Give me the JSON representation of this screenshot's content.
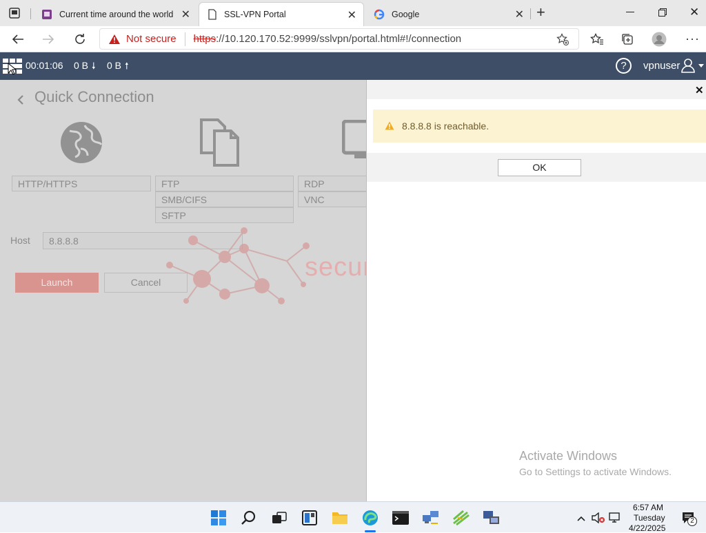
{
  "browser": {
    "tabs": [
      {
        "title": "Current time around the world",
        "active": false
      },
      {
        "title": "SSL-VPN Portal",
        "active": true
      },
      {
        "title": "Google",
        "active": false
      }
    ],
    "address": {
      "security_label": "Not secure",
      "scheme": "https",
      "url_rest": "://10.120.170.52:9999/sslvpn/portal.html#!/connection"
    }
  },
  "portal": {
    "session_time": "00:01:06",
    "bytes_down": "0 B",
    "bytes_up": "0 B",
    "username": "vpnuser"
  },
  "quick_connection": {
    "title": "Quick Connection",
    "col1": [
      "HTTP/HTTPS"
    ],
    "col2": [
      "FTP",
      "SMB/CIFS",
      "SFTP"
    ],
    "col3": [
      "RDP",
      "VNC"
    ],
    "host_label": "Host",
    "host_value": "8.8.8.8",
    "launch_label": "Launch",
    "cancel_label": "Cancel"
  },
  "watermark": "securityzone.vn",
  "dialog": {
    "message": "8.8.8.8 is reachable.",
    "ok_label": "OK"
  },
  "activate_windows": {
    "title": "Activate Windows",
    "subtitle": "Go to Settings to activate Windows."
  },
  "taskbar": {
    "time": "6:57 AM",
    "day": "Tuesday",
    "date": "4/22/2025",
    "notification_count": "2"
  },
  "colors": {
    "portal_bar": "#3e4e67",
    "warning_bg": "#fcf3d3",
    "warning_icon": "#f0ad1e",
    "launch_button": "#d9948f",
    "not_secure": "#c5221f",
    "watermark": "#e8a8a8"
  }
}
